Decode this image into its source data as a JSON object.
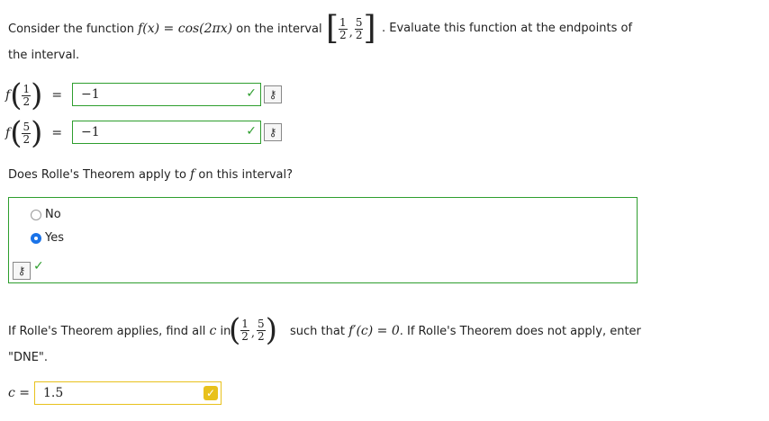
{
  "q1": {
    "intro_pre": "Consider the function ",
    "func_lhs": "f(x) = cos(2πx)",
    "intro_mid": " on the interval ",
    "interval_a_num": "1",
    "interval_a_den": "2",
    "interval_b_num": "5",
    "interval_b_den": "2",
    "intro_post": ". Evaluate this function at the endpoints of",
    "intro_line2": "the interval."
  },
  "eval1": {
    "f": "f",
    "num": "1",
    "den": "2",
    "eq": "=",
    "value": "−1"
  },
  "eval2": {
    "f": "f",
    "num": "5",
    "den": "2",
    "eq": "=",
    "value": "−1"
  },
  "q2": {
    "prompt_pre": "Does Rolle's Theorem apply to ",
    "prompt_f": "f",
    "prompt_post": " on this interval?",
    "options": [
      {
        "label": "No",
        "selected": false
      },
      {
        "label": "Yes",
        "selected": true
      }
    ]
  },
  "q3": {
    "prompt_pre": "If Rolle's Theorem applies, find all ",
    "prompt_c": "c",
    "prompt_in": " in",
    "open_a_num": "1",
    "open_a_den": "2",
    "open_b_num": "5",
    "open_b_den": "2",
    "prompt_post1": " such that ",
    "prompt_deriv": "f′(c) = 0",
    "prompt_post2": ". If Rolle's Theorem does not apply, enter",
    "prompt_line2": "\"DNE\".",
    "c_label": "c =",
    "c_value": "1.5"
  },
  "colors": {
    "correct": "#2e9e2e",
    "partial": "#e8c11c",
    "radio_selected": "#1a73e8"
  },
  "icons": {
    "check": "check-icon",
    "key": "key-icon"
  }
}
